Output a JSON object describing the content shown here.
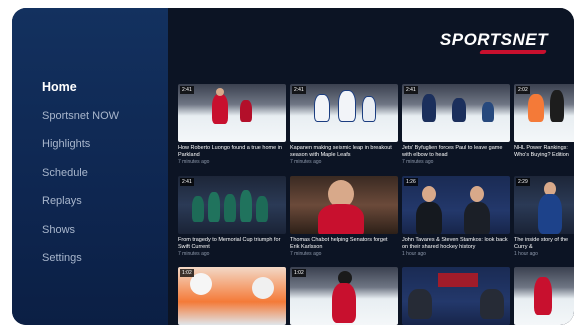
{
  "brand": {
    "logo_text": "SPORTSNET",
    "accent": "#c8102e"
  },
  "nav": {
    "items": [
      {
        "label": "Home",
        "active": true
      },
      {
        "label": "Sportsnet NOW",
        "active": false
      },
      {
        "label": "Highlights",
        "active": false
      },
      {
        "label": "Schedule",
        "active": false
      },
      {
        "label": "Replays",
        "active": false
      },
      {
        "label": "Shows",
        "active": false
      },
      {
        "label": "Settings",
        "active": false
      }
    ]
  },
  "cards": [
    {
      "duration": "2:41",
      "title": "How Roberto Luongo found a true home in Parkland",
      "meta": "7 minutes ago"
    },
    {
      "duration": "2:41",
      "title": "Kapanen making seismic leap in breakout season with Maple Leafs",
      "meta": "7 minutes ago"
    },
    {
      "duration": "2:41",
      "title": "Jets' Byfuglien forces Paul to leave game with elbow to head",
      "meta": "7 minutes ago"
    },
    {
      "duration": "2:02",
      "title": "NHL Power Rankings: Who's Buying? Edition",
      "meta": ""
    },
    {
      "duration": "2:41",
      "title": "From tragedy to Memorial Cup triumph for Swift Current",
      "meta": "7 minutes ago"
    },
    {
      "duration": "",
      "title": "Thomas Chabot helping Senators forget Erik Karlsson",
      "meta": "7 minutes ago"
    },
    {
      "duration": "1:26",
      "title": "John Tavares & Steven Stamkos: look back on their shared hockey history",
      "meta": "1 hour ago"
    },
    {
      "duration": "2:29",
      "title": "The inside story of the Curry &",
      "meta": "1 hour ago"
    },
    {
      "duration": "1:02",
      "title": "",
      "meta": ""
    },
    {
      "duration": "1:02",
      "title": "",
      "meta": ""
    },
    {
      "duration": "",
      "title": "",
      "meta": ""
    },
    {
      "duration": "",
      "title": "",
      "meta": ""
    }
  ]
}
